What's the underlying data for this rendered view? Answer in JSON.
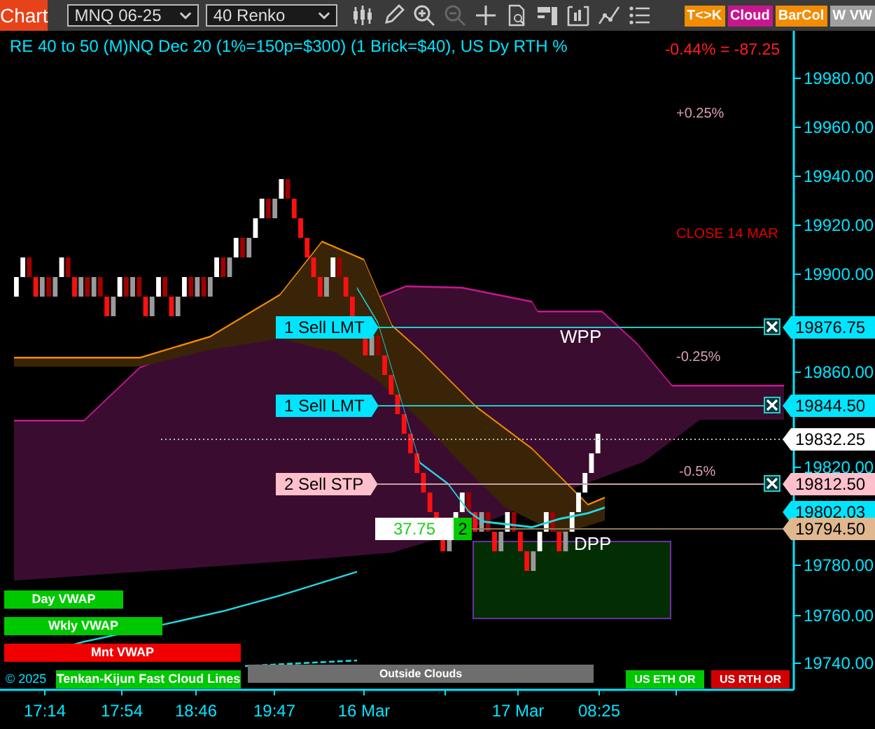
{
  "toolbar": {
    "app_button": "Chart",
    "symbol": "MNQ 06-25",
    "bar_type": "40 Renko",
    "toggles": [
      {
        "label": "T<>K",
        "color": "#f28c00"
      },
      {
        "label": "Cloud",
        "color": "#c8168e"
      },
      {
        "label": "BarCol",
        "color": "#f28c00"
      },
      {
        "label": "W VW",
        "color": "#a0a0a0"
      }
    ]
  },
  "chart": {
    "title": "RE 40 to 50 (M)NQ Dec 20 (1%=150p=$300) (1 Brick=$40), US Dy RTH %",
    "pnl": "-0.44% = -87.25",
    "annotations": [
      {
        "text": "+0.25%",
        "kind": "level"
      },
      {
        "text": "CLOSE 14 MAR",
        "kind": "close"
      },
      {
        "text": "WPP",
        "kind": "pivot"
      },
      {
        "text": "-0.25%",
        "kind": "level"
      },
      {
        "text": "-0.5%",
        "kind": "level"
      },
      {
        "text": "DPP",
        "kind": "pivot"
      }
    ],
    "orders": [
      {
        "label": "1 Sell LMT",
        "price": "19876.75",
        "kind": "limit"
      },
      {
        "label": "1 Sell LMT",
        "price": "19844.50",
        "kind": "limit"
      },
      {
        "label": "2 Sell STP",
        "price": "19812.50",
        "kind": "stop"
      }
    ],
    "price_labels": [
      {
        "price": "19832.25",
        "kind": "last"
      },
      {
        "price": "19802.03",
        "kind": "vwap"
      },
      {
        "price": "19794.50",
        "kind": "position"
      }
    ],
    "position": {
      "pnl": "37.75",
      "quantity": "2"
    },
    "price_ticks": [
      "19980.00",
      "19960.00",
      "19940.00",
      "19920.00",
      "19900.00",
      "19860.00",
      "19820.00",
      "19780.00",
      "19760.00",
      "19740.00"
    ],
    "time_ticks": [
      "17:14",
      "17:54",
      "18:46",
      "19:47",
      "16 Mar",
      "17 Mar",
      "08:25"
    ],
    "legend": [
      {
        "label": "Day VWAP",
        "color": "#00c800"
      },
      {
        "label": "Wkly VWAP",
        "color": "#00c800"
      },
      {
        "label": "Mnt VWAP",
        "color": "#f00000"
      },
      {
        "label": "Tenkan-Kijun Fast Cloud Lines",
        "color": "#00c800"
      }
    ],
    "copyright": "© 2025",
    "badges": [
      {
        "label": "Outside Clouds",
        "color": "#6e6e6e"
      },
      {
        "label": "US ETH OR",
        "color": "#00c800"
      },
      {
        "label": "US RTH OR",
        "color": "#d00000"
      }
    ]
  }
}
